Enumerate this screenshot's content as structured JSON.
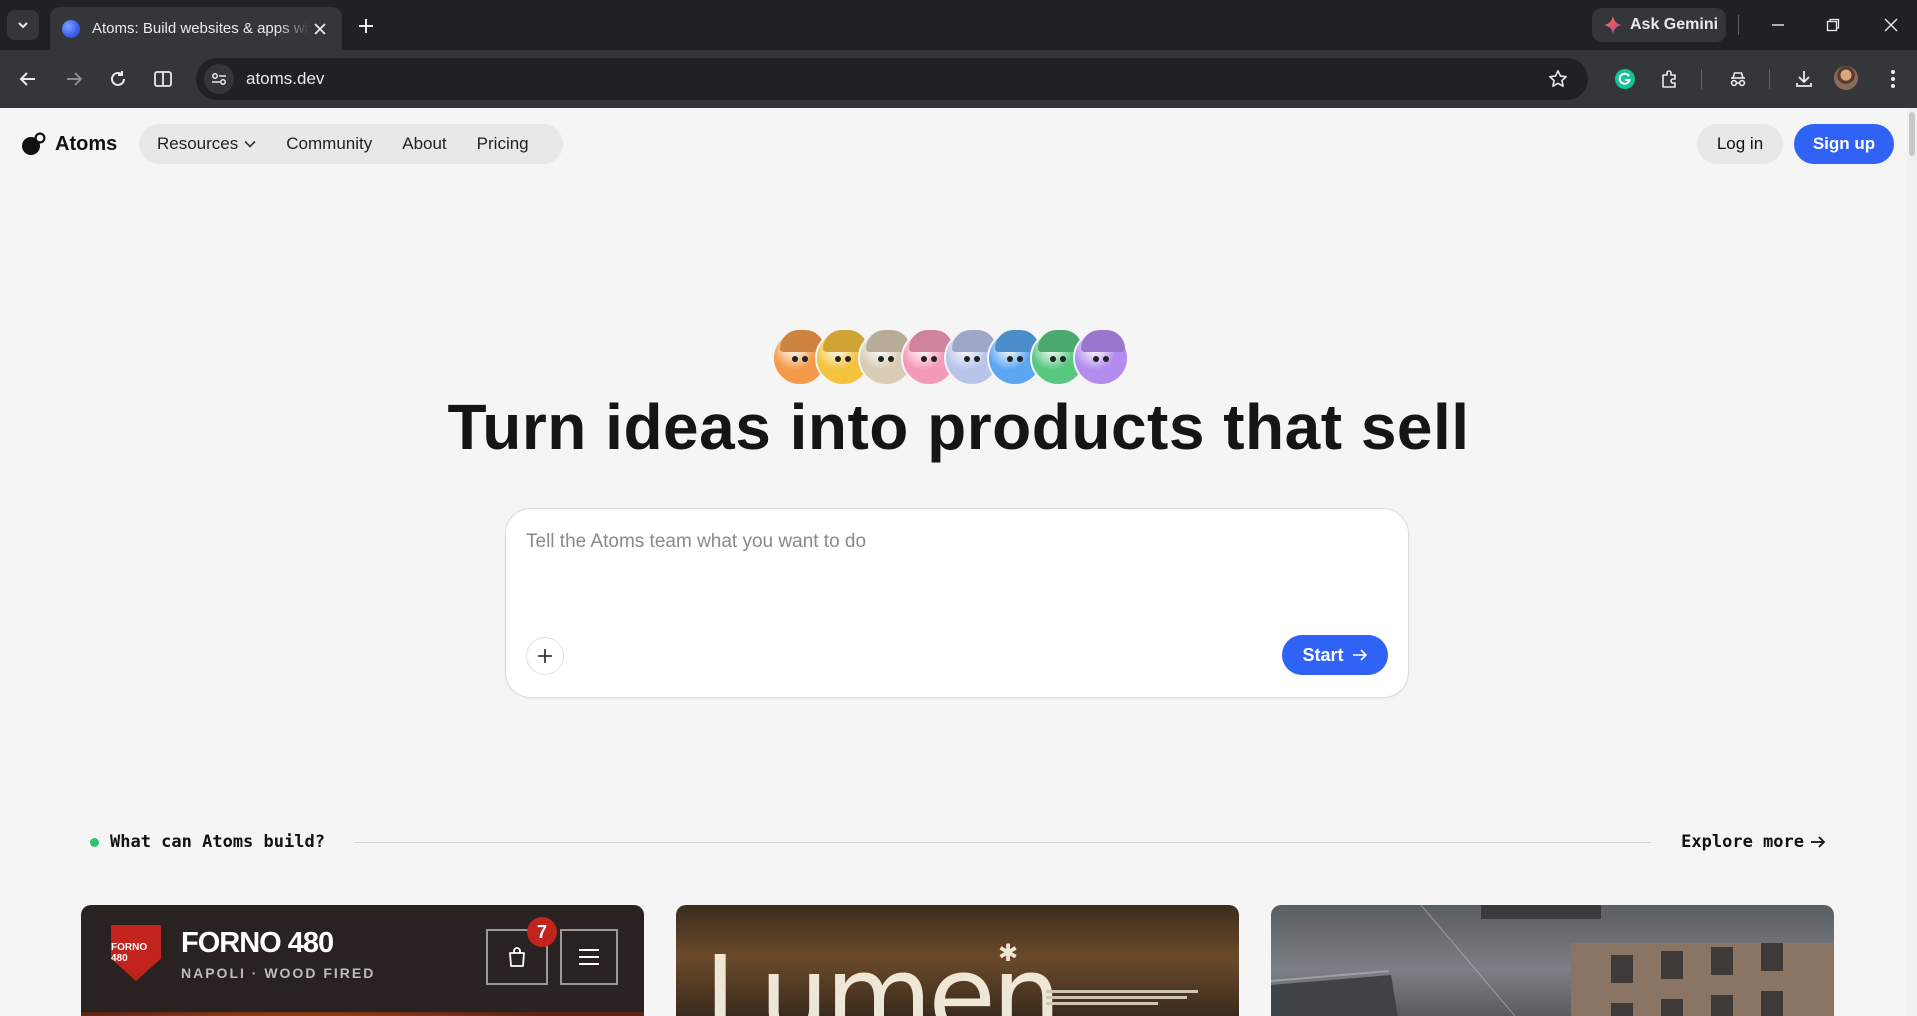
{
  "browser": {
    "tab_title": "Atoms: Build websites & apps with AI",
    "url": "atoms.dev",
    "ask_gemini_label": "Ask Gemini"
  },
  "nav": {
    "brand": "Atoms",
    "items": [
      {
        "label": "Resources",
        "has_dropdown": true
      },
      {
        "label": "Community"
      },
      {
        "label": "About"
      },
      {
        "label": "Pricing"
      }
    ],
    "login_label": "Log in",
    "signup_label": "Sign up"
  },
  "hero": {
    "mascot_colors": [
      "#f29a4a",
      "#f5c23e",
      "#d9cbb4",
      "#f49ab8",
      "#b9c4ea",
      "#5aa6f0",
      "#58c780",
      "#b48cf0"
    ],
    "headline": "Turn ideas into products that sell"
  },
  "prompt": {
    "placeholder": "Tell the Atoms team what you want to do",
    "value": "",
    "start_label": "Start"
  },
  "showcase": {
    "section_title": "What can Atoms build?",
    "explore_label": "Explore more",
    "cards": [
      {
        "brand": "FORNO 480",
        "tagline": "NAPOLI · WOOD FIRED",
        "badge_text": "FORNO 480",
        "cart_count": "7"
      },
      {
        "brand": "Lumen"
      },
      {
        "brand": ""
      }
    ]
  },
  "colors": {
    "accent": "#2f62f5",
    "page_bg": "#f5f5f5",
    "status_dot": "#2fc46b",
    "forno_red": "#c0241c"
  }
}
